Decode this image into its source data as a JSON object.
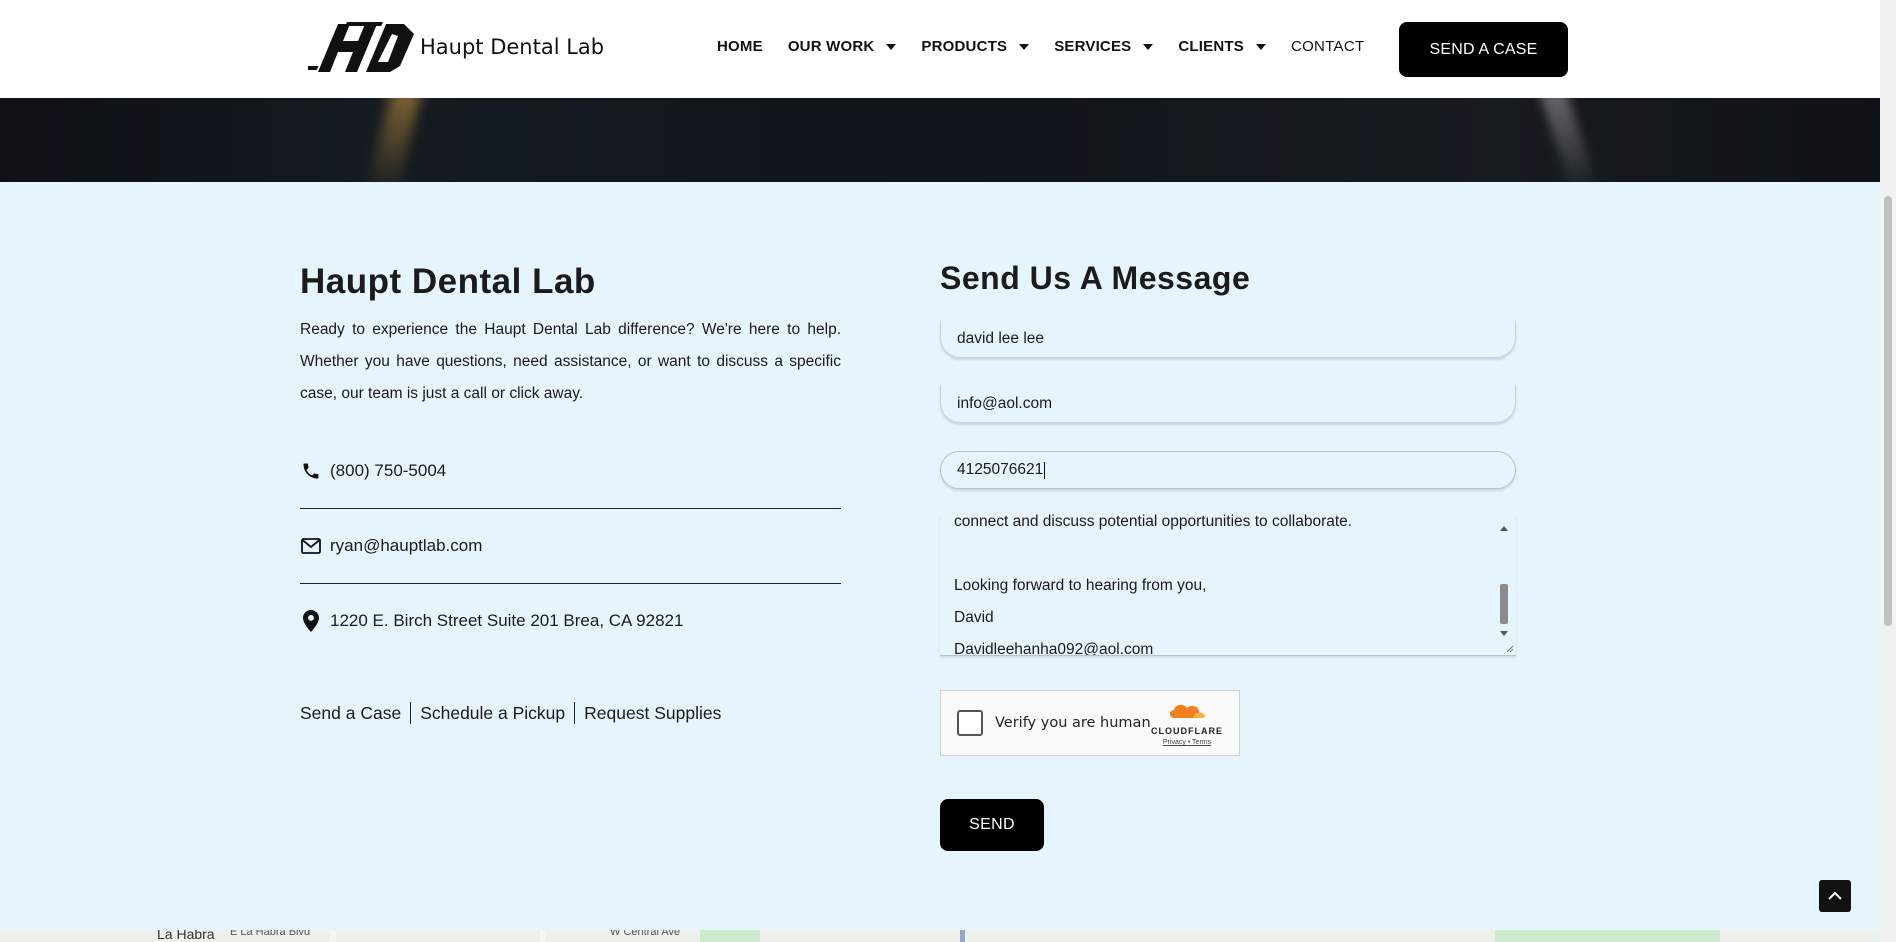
{
  "header": {
    "logo_text": "Haupt Dental Lab",
    "nav": [
      {
        "label": "HOME",
        "dropdown": false
      },
      {
        "label": "OUR WORK",
        "dropdown": true
      },
      {
        "label": "PRODUCTS",
        "dropdown": true
      },
      {
        "label": "SERVICES",
        "dropdown": true
      },
      {
        "label": "CLIENTS",
        "dropdown": true
      },
      {
        "label": "CONTACT",
        "dropdown": false
      }
    ],
    "cta_label": "SEND A CASE"
  },
  "contact": {
    "title": "Haupt Dental Lab",
    "description": "Ready to experience the Haupt Dental Lab difference? We're here to help. Whether you have questions, need assistance, or want to discuss a specific case, our team is just a call or click away.",
    "phone": "(800) 750-5004",
    "email": "ryan@hauptlab.com",
    "address": "1220 E. Birch Street Suite 201 Brea, CA 92821",
    "links": [
      "Send a Case",
      "Schedule a Pickup",
      "Request Supplies"
    ]
  },
  "form": {
    "title": "Send Us A Message",
    "name_value": "david lee lee",
    "email_value": "info@aol.com",
    "phone_value": "4125076621",
    "message_visible": "connect and discuss potential opportunities to collaborate.\n\nLooking forward to hearing from you,\nDavid\nDavidleehanha092@aol.com",
    "captcha_label": "Verify you are human",
    "captcha_brand": "CLOUDFLARE",
    "captcha_links": "Privacy • Terms",
    "submit_label": "SEND"
  },
  "map": {
    "labels": [
      "La Habra",
      "E La Habra Blvd",
      "W Central Ave"
    ]
  },
  "colors": {
    "section_bg": "#e6f4fe",
    "button_bg": "#000000",
    "cloudflare_orange": "#f38020"
  }
}
